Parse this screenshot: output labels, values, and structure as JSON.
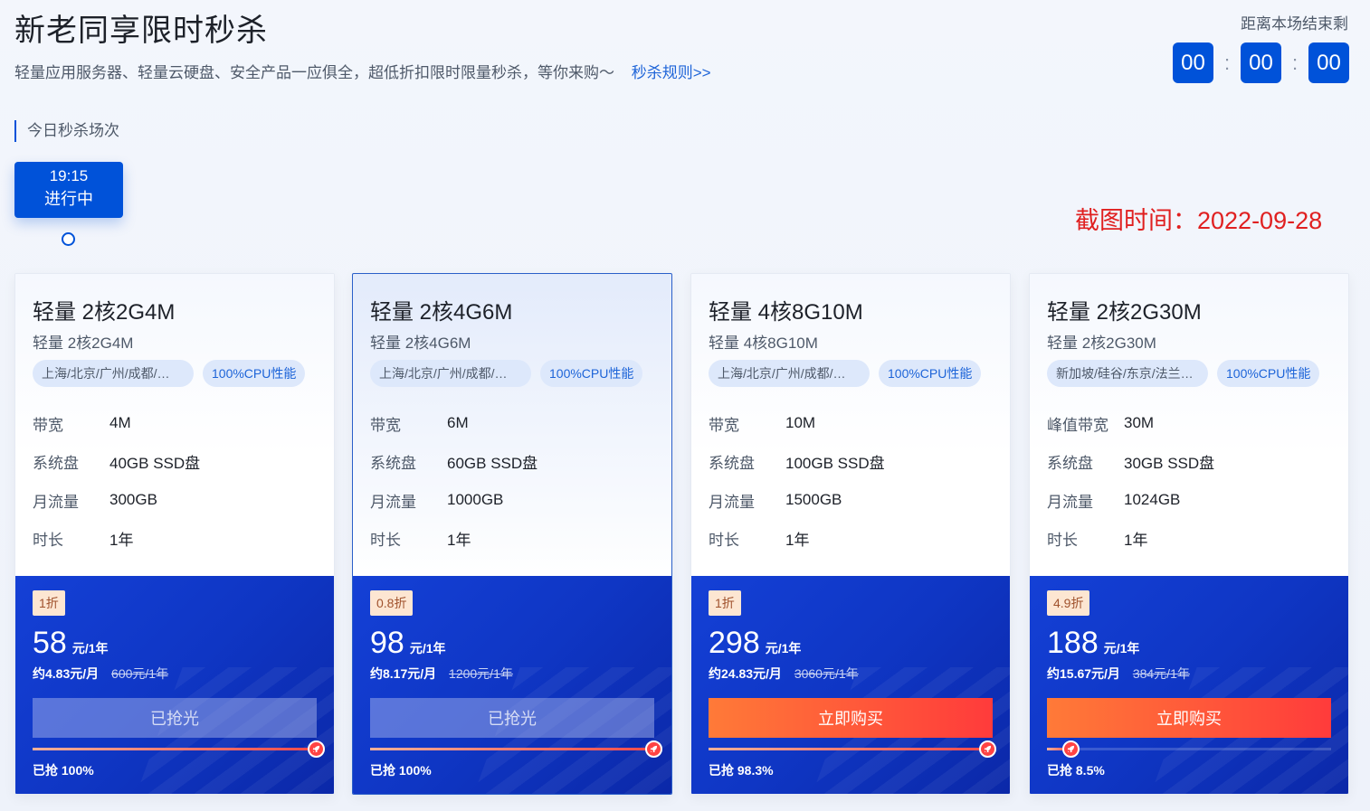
{
  "header": {
    "title": "新老同享限时秒杀",
    "subtitle": "轻量应用服务器、轻量云硬盘、安全产品一应俱全，超低折扣限时限量秒杀，等你来购～",
    "rules_link": "秒杀规则>>",
    "countdown_label": "距离本场结束剩",
    "countdown": {
      "hours": "00",
      "minutes": "00",
      "seconds": "00",
      "separator": ":"
    }
  },
  "sessions": {
    "label": "今日秒杀场次",
    "items": [
      {
        "time": "19:15",
        "status": "进行中"
      }
    ]
  },
  "screenshot_time": "截图时间：2022-09-28",
  "products": [
    {
      "name": "轻量 2核2G4M",
      "sub": "轻量 2核2G4M",
      "region": "上海/北京/广州/成都/…",
      "cpu_tag": "100%CPU性能",
      "specs": [
        {
          "k": "带宽",
          "v": "4M"
        },
        {
          "k": "系统盘",
          "v": "40GB SSD盘"
        },
        {
          "k": "月流量",
          "v": "300GB"
        },
        {
          "k": "时长",
          "v": "1年"
        }
      ],
      "discount": "1折",
      "price": "58",
      "price_unit": "元/1年",
      "monthly": "约4.83元/月",
      "original": "600元/1年",
      "button": "已抢光",
      "button_type": "soldout",
      "progress": 100,
      "grabbed": "已抢 100%"
    },
    {
      "name": "轻量 2核4G6M",
      "sub": "轻量 2核4G6M",
      "region": "上海/北京/广州/成都/…",
      "cpu_tag": "100%CPU性能",
      "specs": [
        {
          "k": "带宽",
          "v": "6M"
        },
        {
          "k": "系统盘",
          "v": "60GB SSD盘"
        },
        {
          "k": "月流量",
          "v": "1000GB"
        },
        {
          "k": "时长",
          "v": "1年"
        }
      ],
      "discount": "0.8折",
      "price": "98",
      "price_unit": "元/1年",
      "monthly": "约8.17元/月",
      "original": "1200元/1年",
      "button": "已抢光",
      "button_type": "soldout",
      "progress": 100,
      "grabbed": "已抢 100%"
    },
    {
      "name": "轻量 4核8G10M",
      "sub": "轻量 4核8G10M",
      "region": "上海/北京/广州/成都/…",
      "cpu_tag": "100%CPU性能",
      "specs": [
        {
          "k": "带宽",
          "v": "10M"
        },
        {
          "k": "系统盘",
          "v": "100GB SSD盘"
        },
        {
          "k": "月流量",
          "v": "1500GB"
        },
        {
          "k": "时长",
          "v": "1年"
        }
      ],
      "discount": "1折",
      "price": "298",
      "price_unit": "元/1年",
      "monthly": "约24.83元/月",
      "original": "3060元/1年",
      "button": "立即购买",
      "button_type": "buy",
      "progress": 98.3,
      "grabbed": "已抢 98.3%"
    },
    {
      "name": "轻量 2核2G30M",
      "sub": "轻量 2核2G30M",
      "region": "新加坡/硅谷/东京/法兰…",
      "cpu_tag": "100%CPU性能",
      "specs": [
        {
          "k": "峰值带宽",
          "v": "30M"
        },
        {
          "k": "系统盘",
          "v": "30GB SSD盘"
        },
        {
          "k": "月流量",
          "v": "1024GB"
        },
        {
          "k": "时长",
          "v": "1年"
        }
      ],
      "discount": "4.9折",
      "price": "188",
      "price_unit": "元/1年",
      "monthly": "约15.67元/月",
      "original": "384元/1年",
      "button": "立即购买",
      "button_type": "buy",
      "progress": 8.5,
      "grabbed": "已抢 8.5%"
    }
  ]
}
